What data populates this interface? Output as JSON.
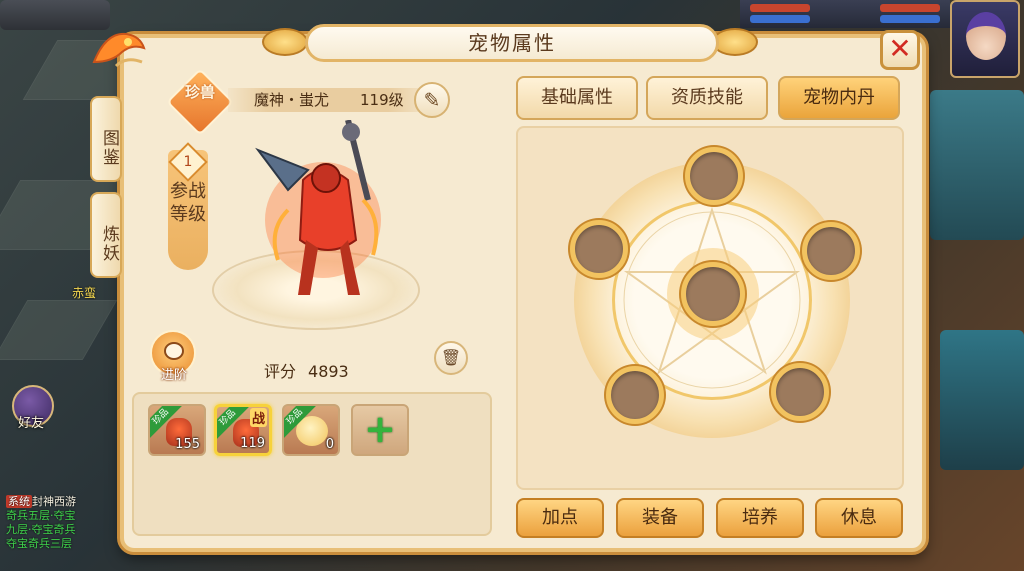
{
  "title": "宠物属性",
  "close_label": "✕",
  "side_tabs": [
    "图鉴",
    "炼妖"
  ],
  "pet": {
    "rarity": "珍兽",
    "name": "魔神・蚩尤",
    "level": "119级",
    "battle_level_num": "1",
    "battle_level_label": "参战等级",
    "score_label": "评分",
    "score_value": "4893",
    "advance_label": "进阶"
  },
  "pet_slots": [
    {
      "ribbon": "珍品",
      "count": "155",
      "selected": false,
      "battle": ""
    },
    {
      "ribbon": "珍品",
      "count": "119",
      "selected": true,
      "battle": "战"
    },
    {
      "ribbon": "珍品",
      "count": "0",
      "selected": false,
      "battle": ""
    }
  ],
  "add_label": "+",
  "tabs": [
    {
      "label": "基础属性",
      "active": false
    },
    {
      "label": "资质技能",
      "active": false
    },
    {
      "label": "宠物内丹",
      "active": true
    }
  ],
  "actions": [
    "加点",
    "装备",
    "培养",
    "休息"
  ],
  "background": {
    "npc_label": "赤蛮",
    "friend_label": "好友",
    "chat": {
      "tag": "系统",
      "line1": "封神西游",
      "lines": [
        "奇兵五层·夺宝",
        "九层·夺宝奇兵",
        "夺宝奇兵三层"
      ]
    }
  },
  "colors": {
    "panel_bg": "#f6ead1",
    "gold_border": "#e8bf77",
    "active_tab": "#eaa43b",
    "close_red": "#d22b22",
    "socket": "#9c7a5d"
  }
}
